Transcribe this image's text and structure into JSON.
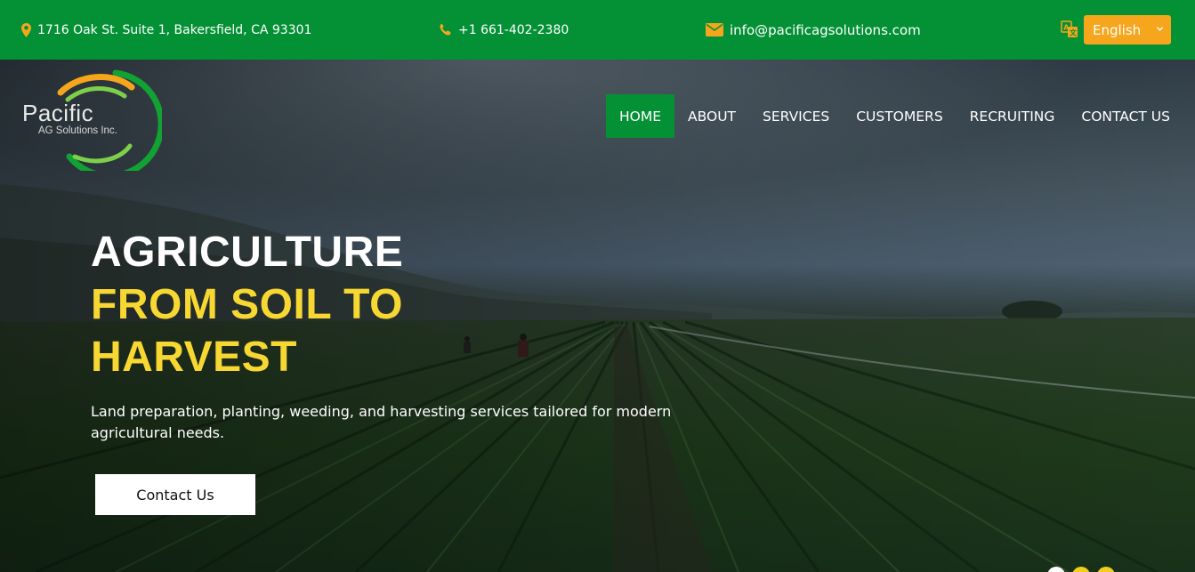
{
  "topbar": {
    "address": "1716 Oak St. Suite 1, Bakersfield, CA 93301",
    "phone": "+1 661-402-2380",
    "email": "info@pacificagsolutions.com",
    "language_selected": "English",
    "icons": {
      "address": "map-pin-icon",
      "phone": "phone-icon",
      "email": "envelope-icon",
      "language": "translate-icon"
    }
  },
  "logo": {
    "name": "Pacific",
    "subtitle": "AG Solutions Inc."
  },
  "nav": {
    "items": [
      {
        "label": "HOME",
        "active": true
      },
      {
        "label": "ABOUT",
        "active": false
      },
      {
        "label": "SERVICES",
        "active": false
      },
      {
        "label": "CUSTOMERS",
        "active": false
      },
      {
        "label": "RECRUITING",
        "active": false
      },
      {
        "label": "CONTACT US",
        "active": false
      }
    ]
  },
  "hero": {
    "headline_line1": "AGRICULTURE",
    "headline_line2": "FROM SOIL TO",
    "headline_line3": "HARVEST",
    "tagline": "Land preparation, planting, weeding, and harvesting services tailored for modern agricultural needs.",
    "cta_label": "Contact Us",
    "slider": {
      "total": 3,
      "active": 1
    }
  },
  "colors": {
    "brand_green": "#049136",
    "accent_orange": "#f6a61c",
    "headline_yellow": "#f7d832",
    "dot_inactive": "#f0d01d"
  }
}
